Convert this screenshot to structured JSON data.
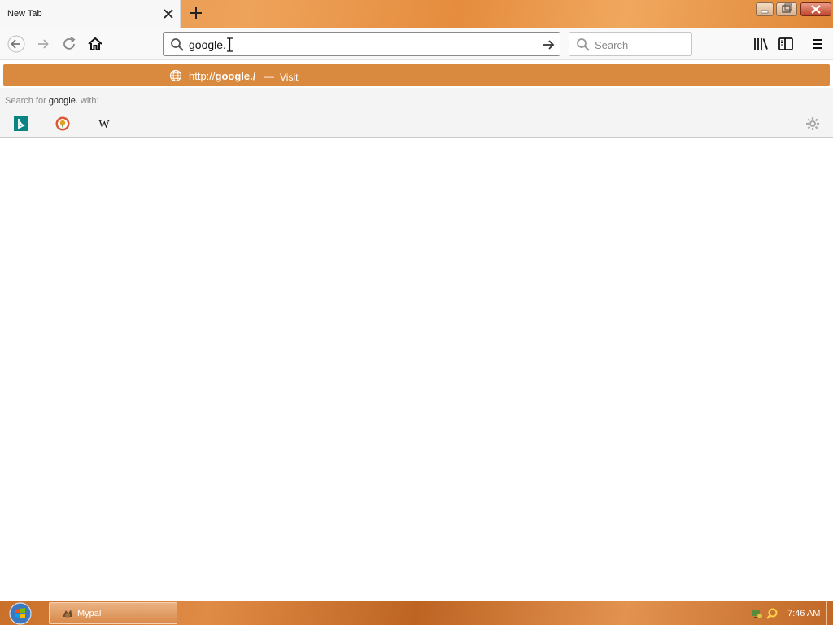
{
  "tab": {
    "title": "New Tab"
  },
  "urlbar": {
    "value": "google."
  },
  "searchbar": {
    "placeholder": "Search"
  },
  "autocomplete": {
    "url_prefix": "http://",
    "url_bold": "google./",
    "separator": "—",
    "action": "Visit"
  },
  "oneoff": {
    "prefix": "Search for",
    "query": "google.",
    "suffix": "with:",
    "engines": [
      {
        "name": "bing-icon"
      },
      {
        "name": "duckduckgo-icon"
      },
      {
        "name": "wikipedia-icon",
        "glyph": "W"
      }
    ]
  },
  "taskbar": {
    "app_label": "Mypal",
    "clock": "7:46 AM"
  },
  "colors": {
    "accent": "#d98a3e",
    "taskbar": "#c9702a"
  }
}
